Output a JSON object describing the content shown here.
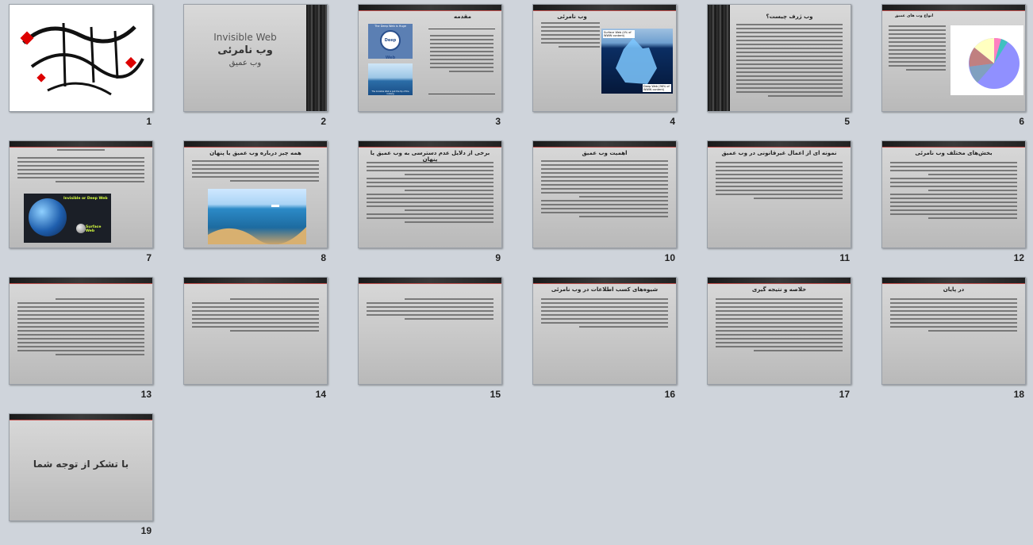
{
  "slides": [
    {
      "number": "1"
    },
    {
      "number": "2",
      "title_en": "Invisible Web",
      "title_fa": "وب نامرئی",
      "subtitle_fa": "وب عمیق"
    },
    {
      "number": "3",
      "title": "مقدمه",
      "img1_label_top": "The Deep Web is Huge",
      "img1_label_center": "Deep Web",
      "img2_caption": "The Invisible Web is just the tip of the iceberg"
    },
    {
      "number": "4",
      "title": "وب نامرئی",
      "label_surface": "Surface Web (4% of WWW content)",
      "label_deep": "Deep Web (96% of WWW content)"
    },
    {
      "number": "5",
      "title": "وب ژرف چیست؟"
    },
    {
      "number": "6",
      "title": "انواع وب های عمیق"
    },
    {
      "number": "7",
      "label_invisible": "Invisible or Deep Web",
      "label_surface": "Surface Web"
    },
    {
      "number": "8",
      "title": "همه چیز درباره وب عمیق یا پنهان"
    },
    {
      "number": "9",
      "title": "برخی از دلایل عدم دسترسی به وب عمیق یا پنهان"
    },
    {
      "number": "10",
      "title": "اهمیت وب عمیق"
    },
    {
      "number": "11",
      "title": "نمونه ای از اعمال غیرقانونی در وب عمیق"
    },
    {
      "number": "12",
      "title": "بخش‌های مختلف وب نامرئی"
    },
    {
      "number": "13"
    },
    {
      "number": "14"
    },
    {
      "number": "15"
    },
    {
      "number": "16",
      "title": "شیوه‌های کسب اطلاعات در وب نامرئی"
    },
    {
      "number": "17",
      "title": "خلاصه و نتیجه گیری"
    },
    {
      "number": "18",
      "title": "در پایان"
    },
    {
      "number": "19",
      "title": "با تشکر از توجه شما"
    }
  ],
  "colors": {
    "background": "#cfd4db",
    "accent": "#c0504d",
    "text": "#222222"
  }
}
